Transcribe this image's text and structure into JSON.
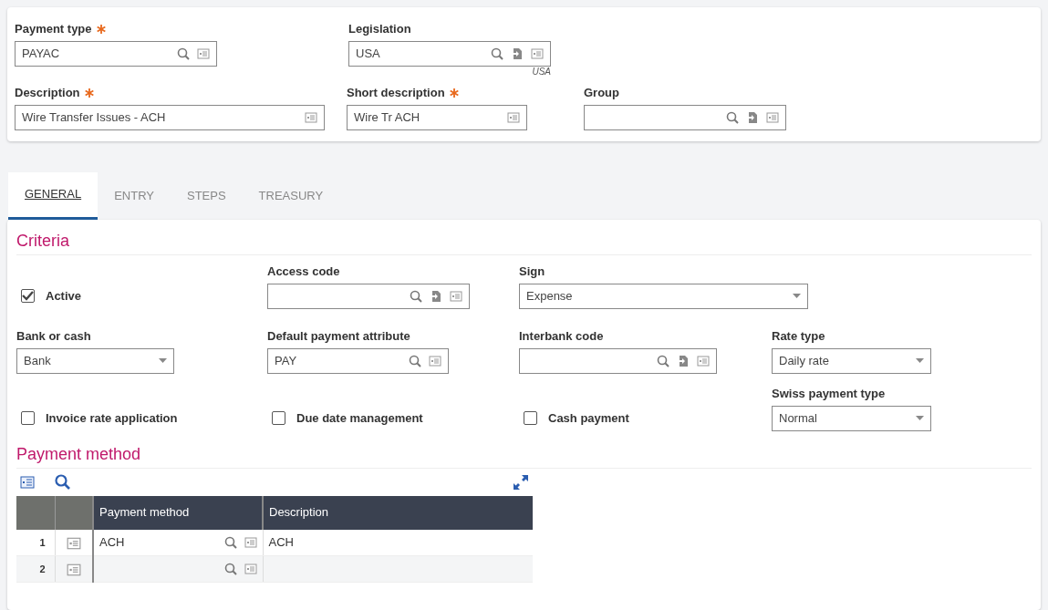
{
  "header": {
    "rows": [
      [
        {
          "kind": "lookup",
          "label": "Payment type",
          "required": true,
          "value": "PAYAC"
        },
        {
          "kind": "lookup_jump",
          "label": "Legislation",
          "required": false,
          "value": "USA",
          "note": "USA"
        }
      ],
      [
        {
          "kind": "text",
          "label": "Description",
          "required": true,
          "value": "Wire Transfer Issues - ACH"
        },
        {
          "kind": "text",
          "label": "Short description",
          "required": true,
          "value": "Wire Tr ACH"
        },
        {
          "kind": "lookup_jump",
          "label": "Group",
          "required": false
        }
      ]
    ]
  },
  "tabs": [
    {
      "label": "GENERAL",
      "selected": true
    },
    {
      "label": "ENTRY",
      "selected": false
    },
    {
      "label": "STEPS",
      "selected": false
    },
    {
      "label": "TREASURY",
      "selected": false
    }
  ],
  "criteria": {
    "title": "Criteria",
    "rows": [
      [
        {
          "kind": "checkbox",
          "label": "Active",
          "checked": true
        },
        {
          "kind": "lookup_jump",
          "label": "Access code"
        },
        {
          "kind": "select",
          "label": "Sign",
          "value": "Expense"
        }
      ],
      [
        {
          "kind": "select",
          "label": "Bank or cash",
          "value": "Bank"
        },
        {
          "kind": "lookup",
          "label": "Default payment attribute",
          "value": "PAY"
        },
        {
          "kind": "lookup_jump",
          "label": "Interbank code"
        },
        {
          "kind": "select",
          "label": "Rate type",
          "value": "Daily rate"
        }
      ],
      [
        {
          "kind": "checkbox",
          "label": "Invoice rate application",
          "checked": false
        },
        {
          "kind": "checkbox",
          "label": "Due date management",
          "checked": false
        },
        {
          "kind": "checkbox",
          "label": "Cash payment",
          "checked": false
        },
        {
          "kind": "select",
          "label": "Swiss payment type",
          "value": "Normal"
        }
      ]
    ]
  },
  "payment_method": {
    "title": "Payment method",
    "columns": [
      "Payment method",
      "Description"
    ],
    "rows": [
      {
        "number": "1",
        "payment_method": "ACH",
        "description": "ACH"
      },
      {
        "number": "2"
      }
    ]
  }
}
